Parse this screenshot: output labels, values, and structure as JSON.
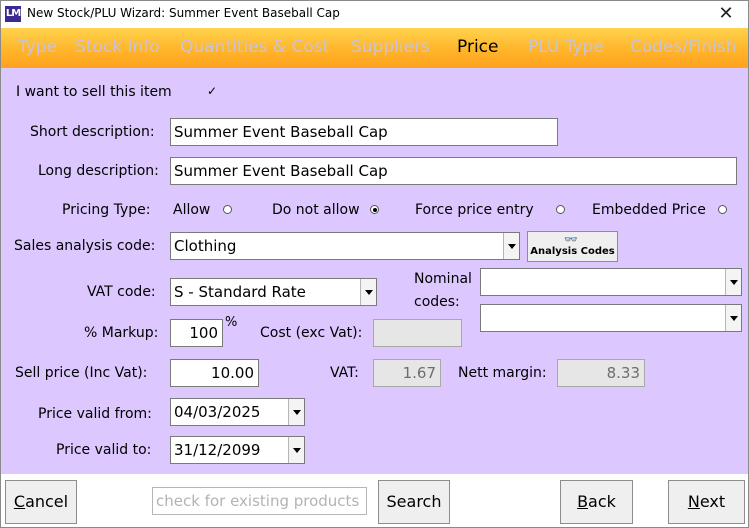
{
  "window": {
    "app_icon_text": "LM",
    "title": "New Stock/PLU Wizard: Summer Event Baseball Cap",
    "close_glyph": "✕"
  },
  "steps": [
    {
      "label": "Type",
      "active": false
    },
    {
      "label": "Stock Info",
      "active": false
    },
    {
      "label": "Quantities & Cost",
      "active": false
    },
    {
      "label": "Suppliers",
      "active": false
    },
    {
      "label": "Price",
      "active": true
    },
    {
      "label": "PLU Type",
      "active": false
    },
    {
      "label": "Codes/Finish",
      "active": false
    }
  ],
  "form": {
    "sell_item_label": "I want to sell this item",
    "sell_item_checked": true,
    "sell_item_mark": "✓",
    "short_desc_label": "Short description:",
    "short_desc_value": "Summer Event Baseball Cap",
    "long_desc_label": "Long description:",
    "long_desc_value": "Summer Event Baseball Cap",
    "pricing_type_label": "Pricing Type:",
    "pricing_options": {
      "allow": "Allow",
      "do_not_allow": "Do not allow",
      "force_price_entry": "Force price entry",
      "embedded_price": "Embedded Price"
    },
    "pricing_selected": "do_not_allow",
    "sales_analysis_label": "Sales analysis code:",
    "sales_analysis_value": "Clothing",
    "analysis_codes_button": "Analysis Codes",
    "analysis_codes_icon": "binoculars-icon",
    "vat_code_label": "VAT code:",
    "vat_code_value": "S - Standard Rate",
    "nominal_codes_label_line1": "Nominal",
    "nominal_codes_label_line2": "codes:",
    "nominal_code_1": "",
    "nominal_code_2": "",
    "markup_label": "% Markup:",
    "markup_value": "100",
    "markup_suffix": "%",
    "cost_label": "Cost (exc Vat):",
    "cost_value": "",
    "sell_price_label": "Sell price (Inc Vat):",
    "sell_price_value": "10.00",
    "vat_label": "VAT:",
    "vat_value": "1.67",
    "nett_margin_label": "Nett margin:",
    "nett_margin_value": "8.33",
    "price_valid_from_label": "Price valid from:",
    "price_valid_from_value": "04/03/2025",
    "price_valid_to_label": "Price valid to:",
    "price_valid_to_value": "31/12/2099"
  },
  "footer": {
    "cancel_label_accel": "C",
    "cancel_label_rest": "ancel",
    "search_placeholder": "check for existing products",
    "search_button": "Search",
    "back_label_accel": "B",
    "back_label_rest": "ack",
    "next_label_accel": "N",
    "next_label_rest": "ext"
  },
  "colors": {
    "body_bg": "#dcc8ff",
    "tab_bar": "#ffb52a",
    "inactive_tab_text": "#c9c3d9"
  }
}
